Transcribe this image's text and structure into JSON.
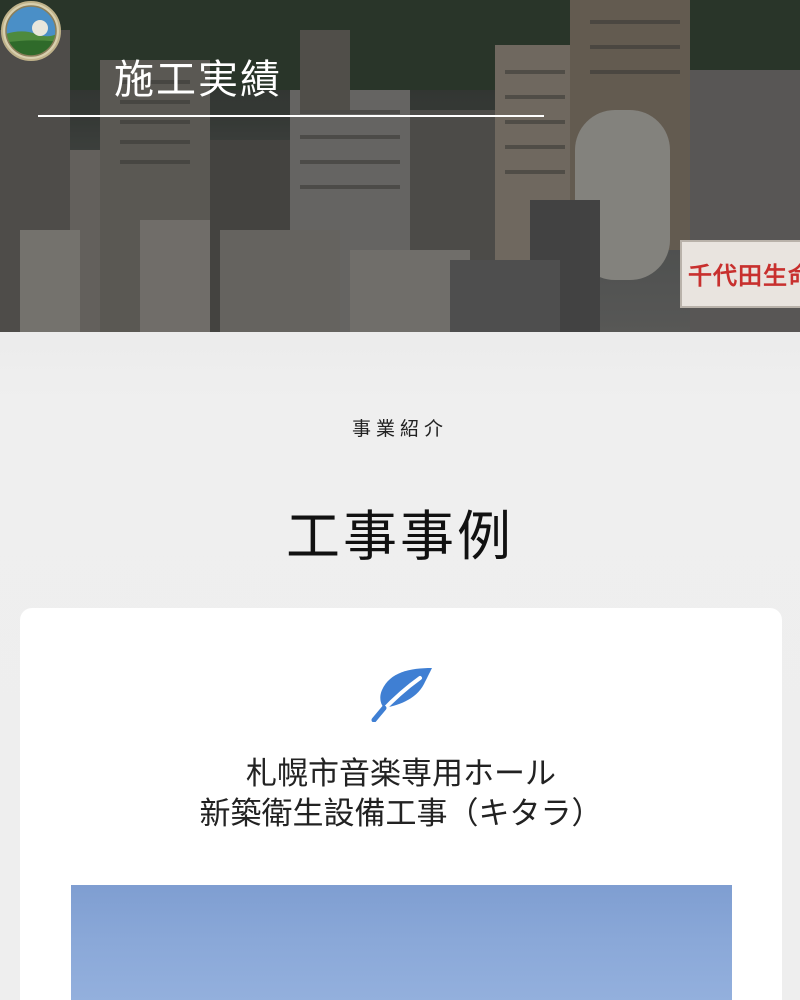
{
  "hero": {
    "title": "施工実績",
    "sign_text": "千代田生命"
  },
  "section": {
    "subtitle": "事業紹介",
    "title": "工事事例"
  },
  "card": {
    "icon": "leaf-icon",
    "title_line1": "札幌市音楽専用ホール",
    "title_line2": "新築衛生設備工事（キタラ）"
  },
  "colors": {
    "accent_blue": "#3f7fd3",
    "card_bg": "#ffffff",
    "page_bg": "#eeeeee",
    "sky_blue": "#8aa8d8"
  }
}
